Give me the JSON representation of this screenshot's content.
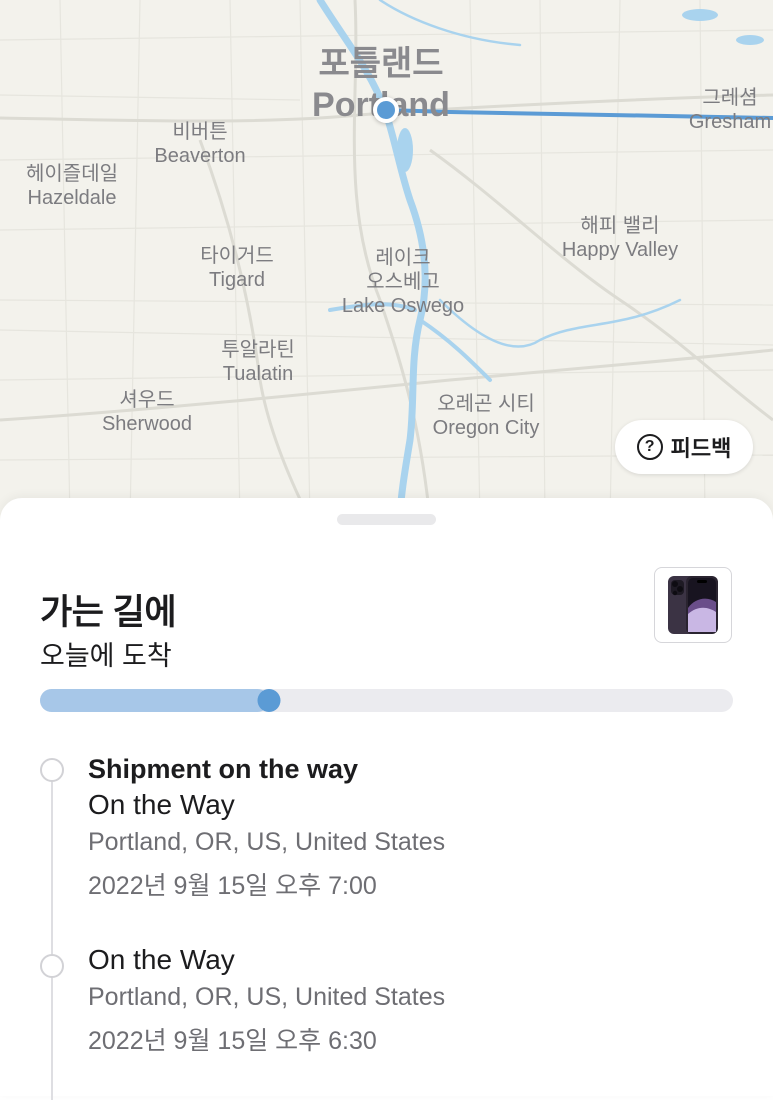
{
  "map": {
    "places": [
      {
        "id": "portland",
        "ko": "포틀랜드",
        "en": "Portland"
      },
      {
        "id": "gresham",
        "ko": "그레셤",
        "en": "Gresham"
      },
      {
        "id": "beaverton",
        "ko": "비버튼",
        "en": "Beaverton"
      },
      {
        "id": "hazeldale",
        "ko": "헤이즐데일",
        "en": "Hazeldale"
      },
      {
        "id": "happy-valley",
        "ko": "해피 밸리",
        "en": "Happy Valley"
      },
      {
        "id": "tigard",
        "ko": "타이거드",
        "en": "Tigard"
      },
      {
        "id": "lake-oswego",
        "ko": "레이크\n오스베고",
        "en": "Lake Oswego"
      },
      {
        "id": "tualatin",
        "ko": "투알라틴",
        "en": "Tualatin"
      },
      {
        "id": "sherwood",
        "ko": "셔우드",
        "en": "Sherwood"
      },
      {
        "id": "oregon-city",
        "ko": "오레곤 시티",
        "en": "Oregon City"
      }
    ],
    "feedback_label": "피드백",
    "feedback_icon": "question-circle-icon",
    "colors": {
      "route": "#5b9bd5",
      "water": "#a9d3ee",
      "land": "#f3f2ec"
    }
  },
  "delivery": {
    "title": "가는 길에",
    "subtitle": "오늘에 도착",
    "progress": 0.33,
    "progress_color": "#5b9bd5"
  },
  "timeline": [
    {
      "title": "Shipment on the way",
      "status": "On the Way",
      "location": "Portland, OR, US, United States",
      "time": "2022년 9월 15일  오후 7:00"
    },
    {
      "title": "",
      "status": "On the Way",
      "location": "Portland, OR, US, United States",
      "time": "2022년 9월 15일  오후 6:30"
    }
  ]
}
